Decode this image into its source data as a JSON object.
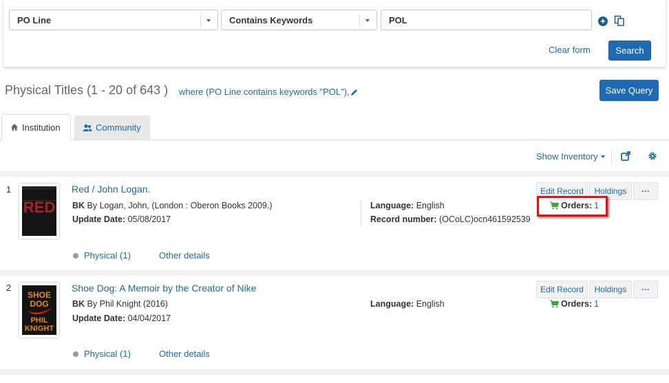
{
  "search": {
    "field1": "PO Line",
    "field2": "Contains Keywords",
    "field3": "POL",
    "clear_label": "Clear form",
    "search_label": "Search"
  },
  "results": {
    "title": "Physical Titles (1 - 20 of 643 )",
    "where": "where (PO Line contains keywords \"POL\"),",
    "save_query_label": "Save Query"
  },
  "tabs": [
    {
      "label": "Institution"
    },
    {
      "label": "Community"
    }
  ],
  "toolbar": {
    "show_inventory_label": "Show Inventory"
  },
  "records": [
    {
      "num": "1",
      "title": "Red / John Logan.",
      "type": "BK",
      "byline": "By Logan, John, (London : Oberon Books 2009.)",
      "update_label": "Update Date:",
      "update_date": "05/08/2017",
      "language_label": "Language:",
      "language": "English",
      "record_number_label": "Record number:",
      "record_number": "(OCoLC)ocn461592539",
      "edit_label": "Edit Record",
      "holdings_label": "Holdings",
      "more_label": "···",
      "orders_label": "Orders:",
      "orders_count": "1",
      "physical_label": "Physical (1)",
      "other_details_label": "Other details"
    },
    {
      "num": "2",
      "title": "Shoe Dog: A Memoir by the Creator of Nike",
      "type": "BK",
      "byline": "By Phil Knight (2016)",
      "update_label": "Update Date:",
      "update_date": "04/04/2017",
      "language_label": "Language:",
      "language": "English",
      "edit_label": "Edit Record",
      "holdings_label": "Holdings",
      "more_label": "···",
      "orders_label": "Orders:",
      "orders_count": "1",
      "physical_label": "Physical (1)",
      "other_details_label": "Other details"
    }
  ],
  "colors": {
    "accent": "#1f6ab3",
    "link": "#1c6aa8",
    "highlight": "#e01313",
    "cart": "#3aa63a"
  }
}
